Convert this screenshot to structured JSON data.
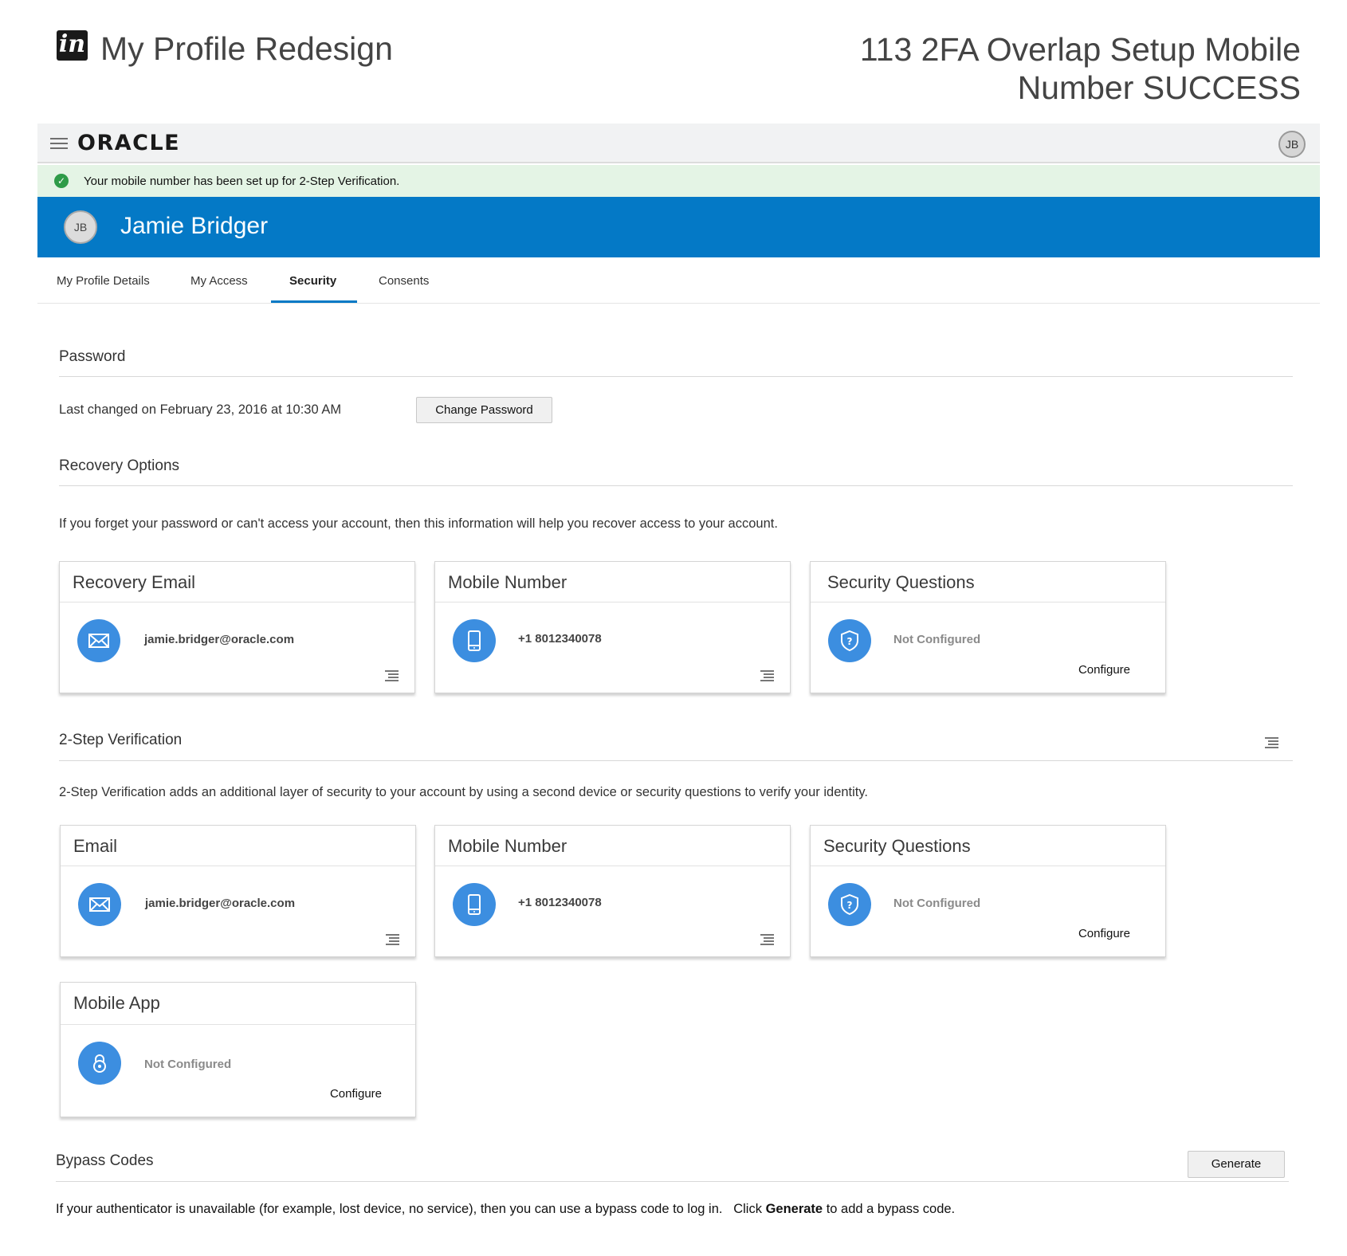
{
  "presentation": {
    "logo_text": "in",
    "project_title": "My Profile Redesign",
    "screen_title": "113 2FA Overlap Setup Mobile Number SUCCESS"
  },
  "topbar": {
    "brand": "ORACLE",
    "user_initials": "JB"
  },
  "banner": {
    "message": "Your mobile number has been set up for 2-Step Verification.",
    "status_color": "#2e9b48"
  },
  "user": {
    "initials": "JB",
    "name": "Jamie Bridger"
  },
  "tabs": [
    {
      "label": "My Profile Details"
    },
    {
      "label": "My Access"
    },
    {
      "label": "Security",
      "active": true
    },
    {
      "label": "Consents"
    }
  ],
  "password": {
    "title": "Password",
    "last_changed": "Last changed on February 23, 2016 at 10:30 AM",
    "change_button": "Change Password"
  },
  "recovery": {
    "title": "Recovery Options",
    "description": "If you forget your password or can't access your account, then this information will help you recover access to your account.",
    "cards": [
      {
        "title": "Recovery Email",
        "icon": "envelope-icon",
        "value": "jamie.bridger@oracle.com"
      },
      {
        "title": "Mobile Number",
        "icon": "phone-icon",
        "value": "+1 8012340078"
      },
      {
        "title": "Security Questions",
        "icon": "shield-question-icon",
        "value": "Not Configured",
        "action": "Configure"
      }
    ]
  },
  "two_step": {
    "title": "2-Step Verification",
    "description": "2-Step Verification adds an additional layer of security to your account by using a second device or security questions to verify your identity.",
    "cards": [
      {
        "title": "Email",
        "icon": "envelope-icon",
        "value": "jamie.bridger@oracle.com"
      },
      {
        "title": "Mobile Number",
        "icon": "phone-icon",
        "value": "+1 8012340078"
      },
      {
        "title": "Security Questions",
        "icon": "shield-question-icon",
        "value": "Not Configured",
        "action": "Configure"
      },
      {
        "title": "Mobile App",
        "icon": "mobile-app-lock-icon",
        "value": "Not Configured",
        "action": "Configure"
      }
    ]
  },
  "bypass": {
    "title": "Bypass Codes",
    "generate_button": "Generate",
    "description_prefix": "If your authenticator is unavailable (for example, lost device, no service), then you can use a bypass code to log in.   Click ",
    "description_bold": "Generate",
    "description_suffix": " to add a bypass code."
  },
  "colors": {
    "brand_blue": "#0479c6",
    "icon_blue": "#3c8ee0",
    "success_bg": "#e4f4e5"
  }
}
